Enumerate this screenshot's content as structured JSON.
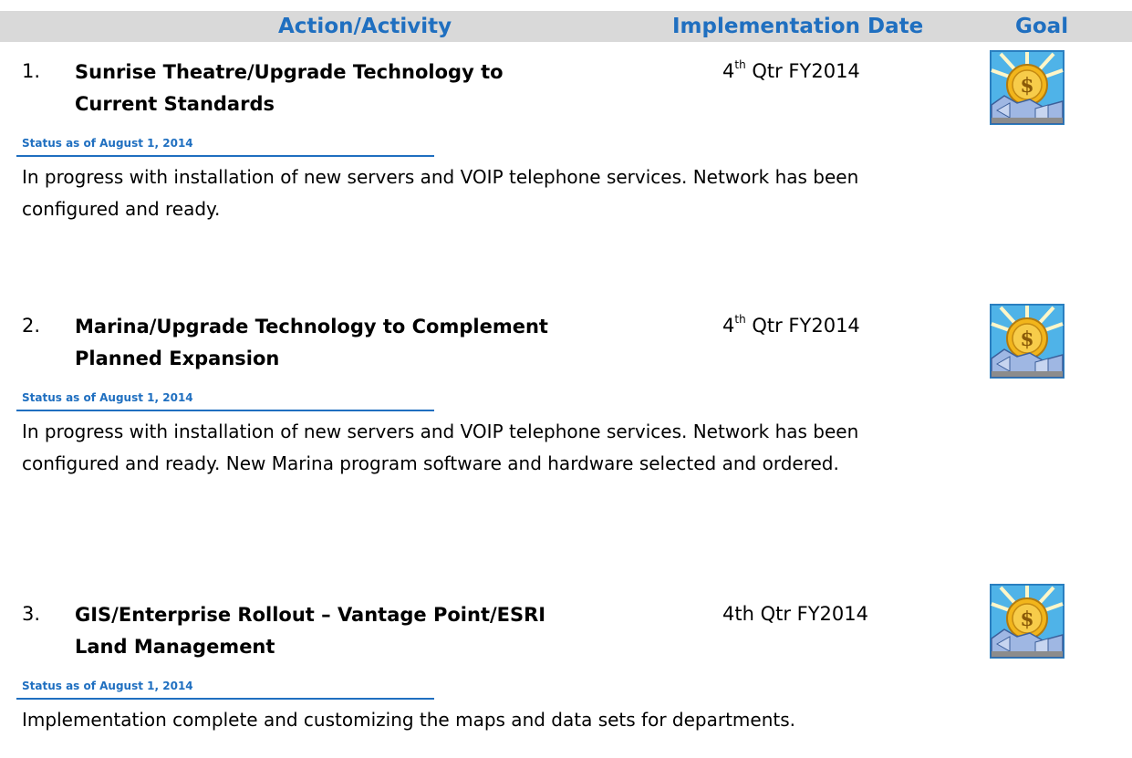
{
  "header": {
    "action_label": "Action/Activity",
    "date_label": "Implementation Date",
    "goal_label": "Goal"
  },
  "items": [
    {
      "number": "1.",
      "title": "Sunrise Theatre/Upgrade Technology to Current Standards",
      "date_num": "4",
      "date_sup": "th",
      "date_rest": " Qtr FY2014",
      "status_label": "Status as of August 1, 2014",
      "status_text": "In progress with installation of new servers and VOIP telephone services. Network has been configured and ready.",
      "goal_icon": "economic-development-sun-coin-icon"
    },
    {
      "number": "2.",
      "title": "Marina/Upgrade Technology to Complement Planned Expansion",
      "date_num": "4",
      "date_sup": "th",
      "date_rest": " Qtr FY2014",
      "status_label": "Status as of August 1, 2014",
      "status_text": "In progress with installation of new servers and VOIP telephone services. Network has been configured and ready.  New Marina program software and hardware selected and ordered.",
      "goal_icon": "economic-development-sun-coin-icon"
    },
    {
      "number": "3.",
      "title": "GIS/Enterprise Rollout – Vantage Point/ESRI Land Management",
      "date_num": "4th Qtr FY2014",
      "date_sup": "",
      "date_rest": "",
      "status_label": "Status as of August 1, 2014",
      "status_text": "Implementation complete and customizing the maps and data sets for departments.",
      "goal_icon": "economic-development-sun-coin-icon"
    }
  ],
  "colors": {
    "header_bg": "#d9d9d9",
    "accent_blue": "#1f6fc0",
    "coin_gold": "#f2b51b",
    "icon_sky": "#4fb3e8"
  }
}
